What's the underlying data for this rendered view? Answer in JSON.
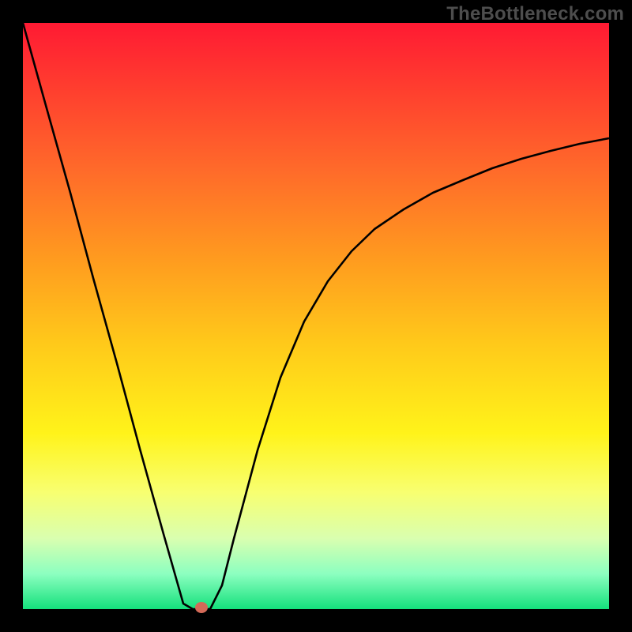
{
  "watermark": "TheBottleneck.com",
  "chart_data": {
    "type": "line",
    "title": "",
    "xlabel": "",
    "ylabel": "",
    "xlim": [
      0,
      1
    ],
    "ylim": [
      0,
      1
    ],
    "series": [
      {
        "name": "curve",
        "x": [
          0.0,
          0.04,
          0.08,
          0.12,
          0.16,
          0.2,
          0.24,
          0.273,
          0.29,
          0.3,
          0.32,
          0.34,
          0.36,
          0.4,
          0.44,
          0.48,
          0.52,
          0.56,
          0.6,
          0.65,
          0.7,
          0.75,
          0.8,
          0.85,
          0.9,
          0.95,
          1.0
        ],
        "values": [
          1.0,
          0.855,
          0.71,
          0.564,
          0.419,
          0.274,
          0.128,
          0.01,
          0.0,
          0.0,
          0.0,
          0.04,
          0.12,
          0.27,
          0.395,
          0.49,
          0.56,
          0.61,
          0.648,
          0.682,
          0.71,
          0.732,
          0.752,
          0.768,
          0.782,
          0.793,
          0.803
        ]
      }
    ],
    "marker": {
      "x": 0.3,
      "y": 0.0,
      "color": "#d46a58"
    },
    "gradient_stops_top_to_bottom": [
      "#ff1a33",
      "#ffca1a",
      "#f8ff70",
      "#14e07c"
    ]
  }
}
